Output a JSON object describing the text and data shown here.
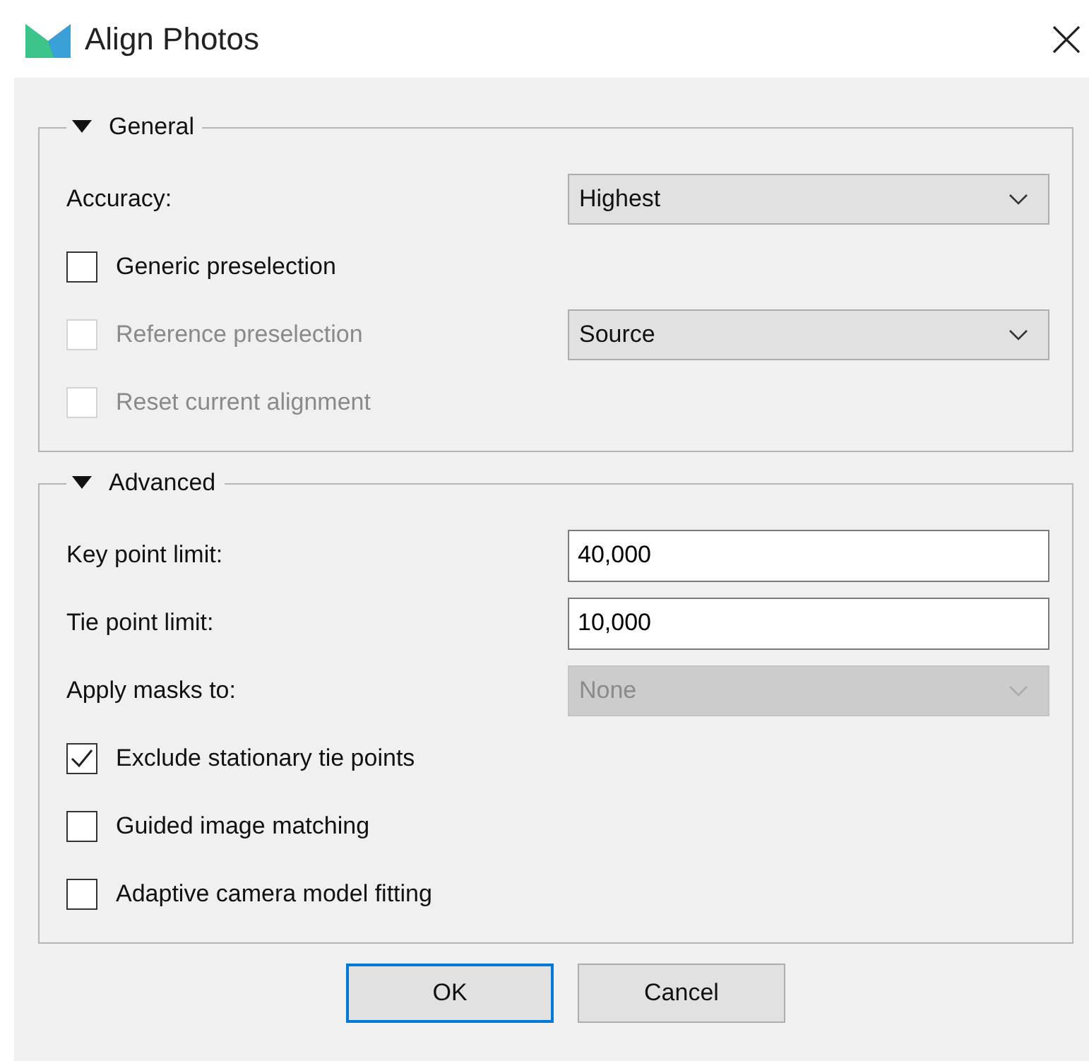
{
  "window": {
    "title": "Align Photos"
  },
  "sections": [
    {
      "title": "General",
      "expanded": true,
      "rows": [
        {
          "kind": "label",
          "label": "Accuracy:",
          "control": {
            "kind": "combo",
            "value": "Highest",
            "disabled": false
          }
        },
        {
          "kind": "checkbox",
          "label": "Generic preselection",
          "checked": false,
          "disabled": false
        },
        {
          "kind": "checkbox",
          "label": "Reference preselection",
          "checked": false,
          "disabled": true,
          "control": {
            "kind": "combo",
            "value": "Source",
            "disabled": false
          }
        },
        {
          "kind": "checkbox",
          "label": "Reset current alignment",
          "checked": false,
          "disabled": true
        }
      ]
    },
    {
      "title": "Advanced",
      "expanded": true,
      "rows": [
        {
          "kind": "label",
          "label": "Key point limit:",
          "control": {
            "kind": "field",
            "value": "40,000",
            "disabled": false
          }
        },
        {
          "kind": "label",
          "label": "Tie point limit:",
          "control": {
            "kind": "field",
            "value": "10,000",
            "disabled": false
          }
        },
        {
          "kind": "label",
          "label": "Apply masks to:",
          "control": {
            "kind": "combo",
            "value": "None",
            "disabled": true
          }
        },
        {
          "kind": "checkbox",
          "label": "Exclude stationary tie points",
          "checked": true,
          "disabled": false
        },
        {
          "kind": "checkbox",
          "label": "Guided image matching",
          "checked": false,
          "disabled": false
        },
        {
          "kind": "checkbox",
          "label": "Adaptive camera model fitting",
          "checked": false,
          "disabled": false
        }
      ]
    }
  ],
  "buttons": [
    {
      "label": "OK",
      "default": true
    },
    {
      "label": "Cancel",
      "default": false
    }
  ]
}
